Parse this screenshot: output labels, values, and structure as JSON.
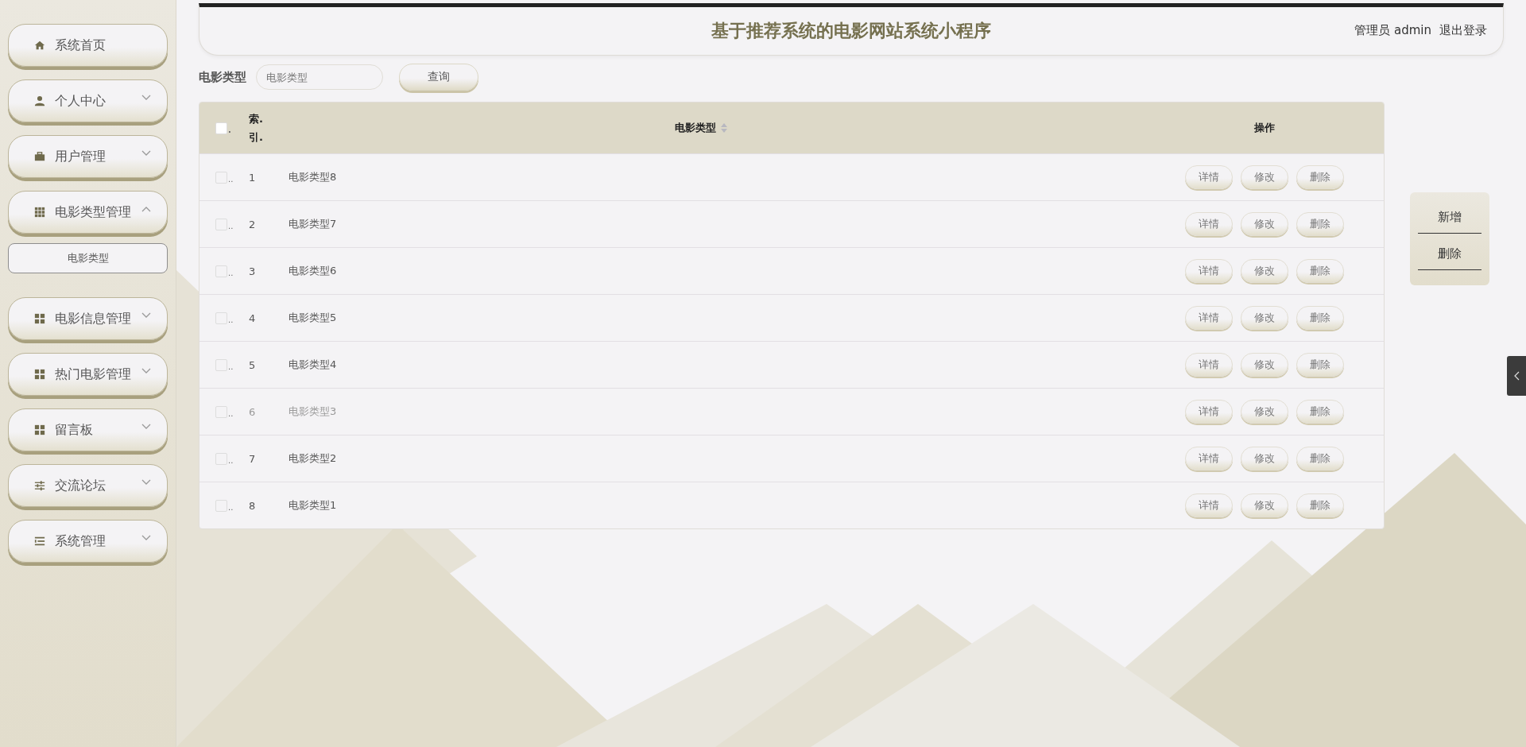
{
  "header": {
    "title": "基于推荐系统的电影网站系统小程序",
    "user": "管理员 admin",
    "logout": "退出登录"
  },
  "sidebar": {
    "items": [
      {
        "label": "系统首页",
        "kind": "home"
      },
      {
        "label": "个人中心",
        "kind": "user",
        "expanded": false
      },
      {
        "label": "用户管理",
        "kind": "briefcase",
        "expanded": false
      },
      {
        "label": "电影类型管理",
        "kind": "grid9",
        "expanded": true,
        "children": [
          {
            "label": "电影类型"
          }
        ]
      },
      {
        "label": "电影信息管理",
        "kind": "grid4",
        "expanded": false
      },
      {
        "label": "热门电影管理",
        "kind": "grid4",
        "expanded": false
      },
      {
        "label": "留言板",
        "kind": "grid4",
        "expanded": false
      },
      {
        "label": "交流论坛",
        "kind": "sliders",
        "expanded": false
      },
      {
        "label": "系统管理",
        "kind": "list",
        "expanded": false
      }
    ]
  },
  "search": {
    "label": "电影类型",
    "placeholder": "电影类型",
    "button": "查询"
  },
  "table": {
    "all_checked": false,
    "columns": [
      {
        "label": "."
      },
      {
        "label": "索.引."
      },
      {
        "label": "电影类型"
      },
      {
        "label": "操作"
      }
    ],
    "rows": [
      {
        "checked": false,
        "mark": "..",
        "index": "1",
        "type": "电影类型8",
        "highlighted": false,
        "actions": [
          "详情",
          "修改",
          "删除"
        ]
      },
      {
        "checked": false,
        "mark": "..",
        "index": "2",
        "type": "电影类型7",
        "highlighted": false,
        "actions": [
          "详情",
          "修改",
          "删除"
        ]
      },
      {
        "checked": false,
        "mark": "..",
        "index": "3",
        "type": "电影类型6",
        "highlighted": false,
        "actions": [
          "详情",
          "修改",
          "删除"
        ]
      },
      {
        "checked": false,
        "mark": "..",
        "index": "4",
        "type": "电影类型5",
        "highlighted": false,
        "actions": [
          "详情",
          "修改",
          "删除"
        ]
      },
      {
        "checked": false,
        "mark": "..",
        "index": "5",
        "type": "电影类型4",
        "highlighted": false,
        "actions": [
          "详情",
          "修改",
          "删除"
        ]
      },
      {
        "checked": false,
        "mark": "..",
        "index": "6",
        "type": "电影类型3",
        "highlighted": true,
        "actions": [
          "详情",
          "修改",
          "删除"
        ]
      },
      {
        "checked": false,
        "mark": "..",
        "index": "7",
        "type": "电影类型2",
        "highlighted": false,
        "actions": [
          "详情",
          "修改",
          "删除"
        ]
      },
      {
        "checked": false,
        "mark": "..",
        "index": "8",
        "type": "电影类型1",
        "highlighted": false,
        "actions": [
          "详情",
          "修改",
          "删除"
        ]
      }
    ]
  },
  "side_actions": [
    "新增",
    "删除"
  ]
}
